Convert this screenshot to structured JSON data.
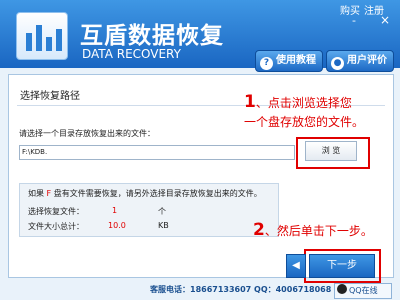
{
  "app": {
    "title": "互盾数据恢复",
    "subtitle": "DATA RECOVERY",
    "buy": "购买",
    "register": "注册",
    "minimize": "-",
    "close": "×",
    "help_btn": "使用教程",
    "review_btn": "用户评价"
  },
  "section_title": "选择恢复路径",
  "hint1": {
    "num": "1",
    "line1": "、点击浏览选择您",
    "line2": "一个盘存放您的文件。"
  },
  "prompt": "请选择一个目录存放恢复出来的文件：",
  "path_value": "F:\\KDB.",
  "browse_label": "浏  览",
  "info": {
    "line1_a": "如果 ",
    "line1_drive": "F",
    "line1_b": " 盘有文件需要恢复，请另外选择目录存放恢复出来的文件。",
    "count_label": "选择恢复文件：",
    "count_value": "1",
    "count_unit": "个",
    "size_label": "文件大小总计：",
    "size_value": "10.0",
    "size_unit": "KB"
  },
  "hint2": {
    "num": "2",
    "text": "、然后单击下一步。"
  },
  "back_symbol": "◀",
  "next_label": "下一步",
  "footer": "客服电话：18667133607  QQ：4006718068",
  "qq_label": "QQ在线",
  "colors": {
    "header": "#1a66c2",
    "hint": "#e00000"
  }
}
